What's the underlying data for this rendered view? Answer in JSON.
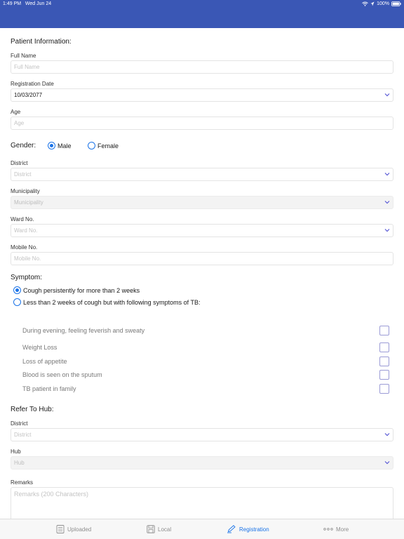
{
  "status_bar": {
    "time": "1:49 PM",
    "date": "Wed Jun 24",
    "battery": "100%"
  },
  "patient_info": {
    "section_title": "Patient Information:",
    "full_name": {
      "label": "Full Name",
      "placeholder": "Full Name"
    },
    "registration_date": {
      "label": "Registration Date",
      "value": "10/03/2077"
    },
    "age": {
      "label": "Age",
      "placeholder": "Age"
    },
    "gender": {
      "label": "Gender:",
      "options": [
        "Male",
        "Female"
      ],
      "selected": "Male"
    },
    "district": {
      "label": "District",
      "placeholder": "District"
    },
    "municipality": {
      "label": "Municipality",
      "placeholder": "Municipality"
    },
    "ward": {
      "label": "Ward No.",
      "placeholder": "Ward No."
    },
    "mobile": {
      "label": "Mobile No.",
      "placeholder": "Mobile No."
    }
  },
  "symptom": {
    "section_title": "Symptom:",
    "options": [
      "Cough persistently for more than 2 weeks",
      "Less than 2 weeks of cough but with following symptoms of TB:"
    ],
    "selected_index": 0,
    "checklist": [
      {
        "label": "During evening, feeling feverish and sweaty",
        "checked": false
      },
      {
        "label": "Weight Loss",
        "checked": false
      },
      {
        "label": "Loss of appetite",
        "checked": false
      },
      {
        "label": "Blood is seen on the sputum",
        "checked": false
      },
      {
        "label": "TB patient in family",
        "checked": false
      }
    ]
  },
  "refer_hub": {
    "section_title": "Refer To Hub:",
    "district": {
      "label": "District",
      "placeholder": "District"
    },
    "hub": {
      "label": "Hub",
      "placeholder": "Hub"
    },
    "remarks": {
      "label": "Remarks",
      "placeholder": "Remarks (200 Characters)"
    }
  },
  "tabs": [
    {
      "label": "Uploaded",
      "icon": "list-icon",
      "active": false
    },
    {
      "label": "Local",
      "icon": "save-icon",
      "active": false
    },
    {
      "label": "Registration",
      "icon": "edit-icon",
      "active": true
    },
    {
      "label": "More",
      "icon": "more-icon",
      "active": false
    }
  ],
  "colors": {
    "header": "#3a57b5",
    "accent": "#1a73e8",
    "checkbox_border": "#9b9bd6"
  }
}
